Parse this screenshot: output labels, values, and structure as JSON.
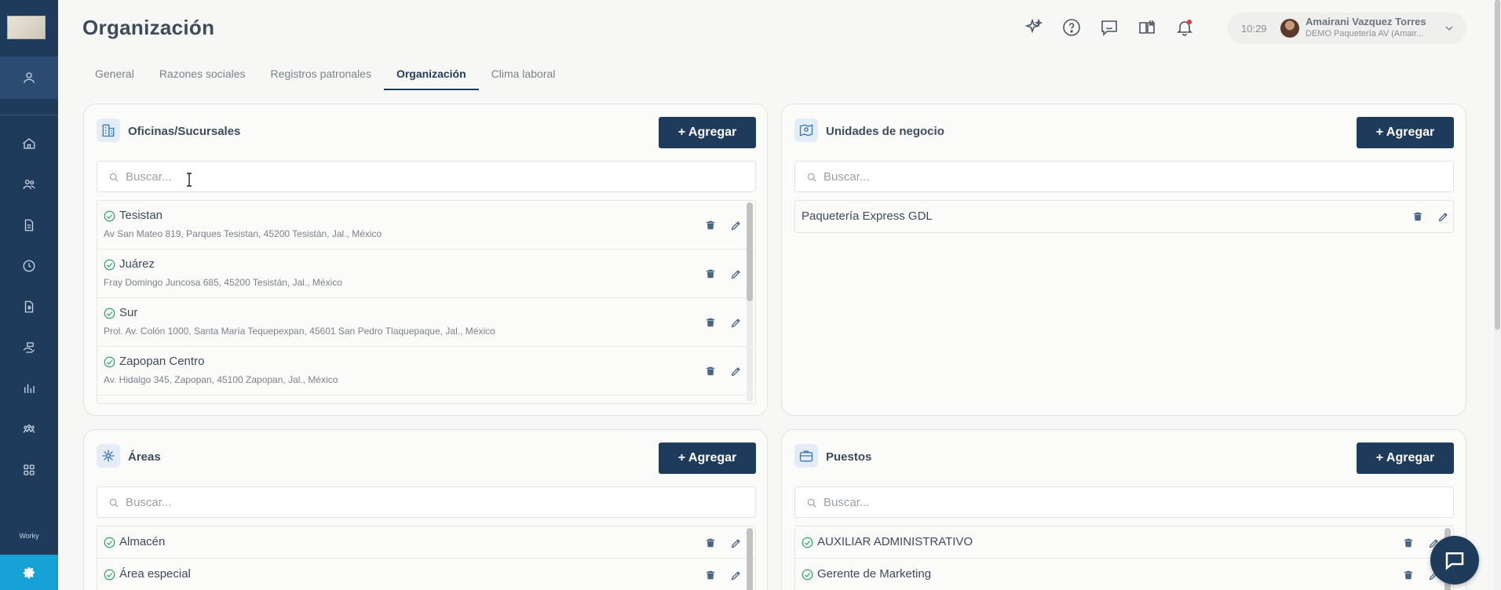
{
  "header": {
    "title": "Organización",
    "time": "10:29",
    "user_name": "Amairani Vazquez Torres",
    "user_org": "DEMO Paquetería AV (Amair..."
  },
  "sidebar": {
    "items": [
      "user-icon",
      "home-icon",
      "people-icon",
      "document-icon",
      "clock-icon",
      "file-money-icon",
      "hand-money-icon",
      "chart-icon",
      "team-icon",
      "grid-icon"
    ],
    "brand": "Worky"
  },
  "tabs": [
    {
      "label": "General",
      "active": false
    },
    {
      "label": "Razones sociales",
      "active": false
    },
    {
      "label": "Registros patronales",
      "active": false
    },
    {
      "label": "Organización",
      "active": true
    },
    {
      "label": "Clima laboral",
      "active": false
    }
  ],
  "common": {
    "add_label": "+ Agregar",
    "search_placeholder": "Buscar..."
  },
  "oficinas": {
    "title": "Oficinas/Sucursales",
    "items": [
      {
        "name": "Tesistan",
        "address": "Av San Mateo 819, Parques Tesistan, 45200 Tesistán, Jal., México"
      },
      {
        "name": "Juárez",
        "address": "Fray Domingo Juncosa 685, 45200 Tesistán, Jal., México"
      },
      {
        "name": "Sur",
        "address": "Prol. Av. Colón 1000, Santa María Tequepexpan, 45601 San Pedro Tlaquepaque, Jal., México"
      },
      {
        "name": "Zapopan Centro",
        "address": "Av. Hidalgo 345, Zapopan, 45100 Zapopan, Jal., México"
      }
    ]
  },
  "unidades": {
    "title": "Unidades de negocio",
    "items": [
      {
        "name": "Paquetería Express GDL"
      }
    ]
  },
  "areas": {
    "title": "Áreas",
    "items": [
      {
        "name": "Almacén"
      },
      {
        "name": "Área especial"
      }
    ]
  },
  "puestos": {
    "title": "Puestos",
    "items": [
      {
        "name": "AUXILIAR ADMINISTRATIVO"
      },
      {
        "name": "Gerente de Marketing"
      }
    ]
  },
  "colors": {
    "primary": "#1f3b5c",
    "accent": "#17a2d6",
    "success": "#2fa36b",
    "notification": "#e53935"
  }
}
